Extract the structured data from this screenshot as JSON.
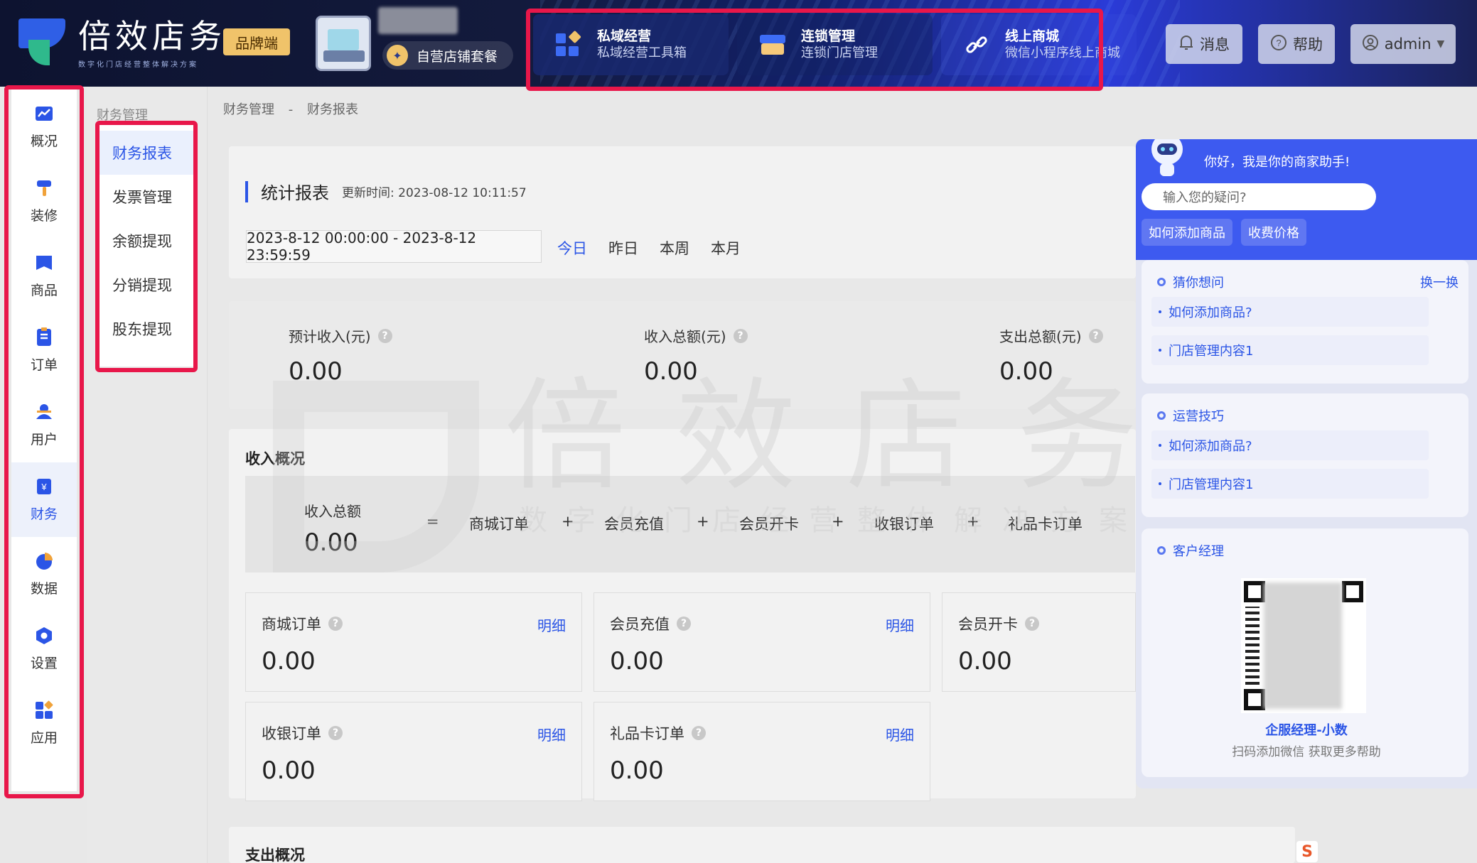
{
  "header": {
    "logo_title": "倍效店务",
    "logo_subtitle": "数字化门店经营整体解决方案",
    "brand_badge": "品牌端",
    "package_label": "自营店铺套餐",
    "tiles": [
      {
        "title": "私域经营",
        "subtitle": "私域经营工具箱",
        "icon": "grid-icon"
      },
      {
        "title": "连锁管理",
        "subtitle": "连锁门店管理",
        "icon": "store-icon"
      },
      {
        "title": "线上商城",
        "subtitle": "微信小程序线上商城",
        "icon": "link-icon"
      }
    ],
    "messages_label": "消息",
    "help_label": "帮助",
    "user_label": "admin"
  },
  "sidebar": {
    "items": [
      {
        "label": "概况",
        "icon": "chart-icon",
        "color": "#2b55e6"
      },
      {
        "label": "装修",
        "icon": "brush-icon",
        "color": "#2b55e6"
      },
      {
        "label": "商品",
        "icon": "goods-icon",
        "color": "#2b55e6"
      },
      {
        "label": "订单",
        "icon": "order-icon",
        "color": "#2b55e6"
      },
      {
        "label": "用户",
        "icon": "user-icon",
        "color": "#2b55e6"
      },
      {
        "label": "财务",
        "icon": "finance-icon",
        "color": "#2b55e6"
      },
      {
        "label": "数据",
        "icon": "pie-icon",
        "color": "#2b55e6"
      },
      {
        "label": "设置",
        "icon": "settings-icon",
        "color": "#2b55e6"
      },
      {
        "label": "应用",
        "icon": "apps-icon",
        "color": "#2b55e6"
      }
    ],
    "active_index": 5
  },
  "submenu": {
    "section": "财务管理",
    "items": [
      "财务报表",
      "发票管理",
      "余额提现",
      "分销提现",
      "股东提现"
    ]
  },
  "breadcrumb": {
    "first": "财务管理",
    "sep": "-",
    "second": "财务报表"
  },
  "report": {
    "title": "统计报表",
    "updated_prefix": "更新时间:",
    "updated_time": "2023-08-12 10:11:57",
    "date_range": "2023-8-12 00:00:00 - 2023-8-12 23:59:59",
    "quick": [
      "今日",
      "昨日",
      "本周",
      "本月"
    ]
  },
  "stats": [
    {
      "label": "预计收入(元)",
      "value": "0.00"
    },
    {
      "label": "收入总额(元)",
      "value": "0.00"
    },
    {
      "label": "支出总额(元)",
      "value": "0.00"
    }
  ],
  "watermark": {
    "big": "倍效店务",
    "small": "数字化门店经营整体解决方案"
  },
  "income": {
    "title": "收入概况",
    "total_label": "收入总额",
    "total_value": "0.00",
    "eq": "=",
    "plus": "+",
    "parts": [
      "商城订单",
      "会员充值",
      "会员开卡",
      "收银订单",
      "礼品卡订单"
    ],
    "cards": [
      {
        "label": "商城订单",
        "value": "0.00",
        "link": "明细"
      },
      {
        "label": "会员充值",
        "value": "0.00",
        "link": "明细"
      },
      {
        "label": "会员开卡",
        "value": "0.00",
        "link": ""
      },
      {
        "label": "收银订单",
        "value": "0.00",
        "link": "明细"
      },
      {
        "label": "礼品卡订单",
        "value": "0.00",
        "link": "明细"
      }
    ]
  },
  "expense": {
    "title": "支出概况"
  },
  "assistant": {
    "greeting": "你好，我是你的商家助手!",
    "input_placeholder": "输入您的疑问?",
    "chips": [
      "如何添加商品",
      "收费价格"
    ],
    "guess": {
      "title": "猜你想问",
      "refresh": "换一换",
      "items": [
        "如何添加商品?",
        "门店管理内容1"
      ]
    },
    "tips": {
      "title": "运营技巧",
      "items": [
        "如何添加商品?",
        "门店管理内容1"
      ]
    },
    "manager": {
      "title": "客户经理",
      "name": "企服经理-小数",
      "note": "扫码添加微信 获取更多帮助"
    }
  },
  "colors": {
    "accent": "#2b55e6",
    "highlight": "#e8174a",
    "brand_gold": "#f0c36a"
  }
}
